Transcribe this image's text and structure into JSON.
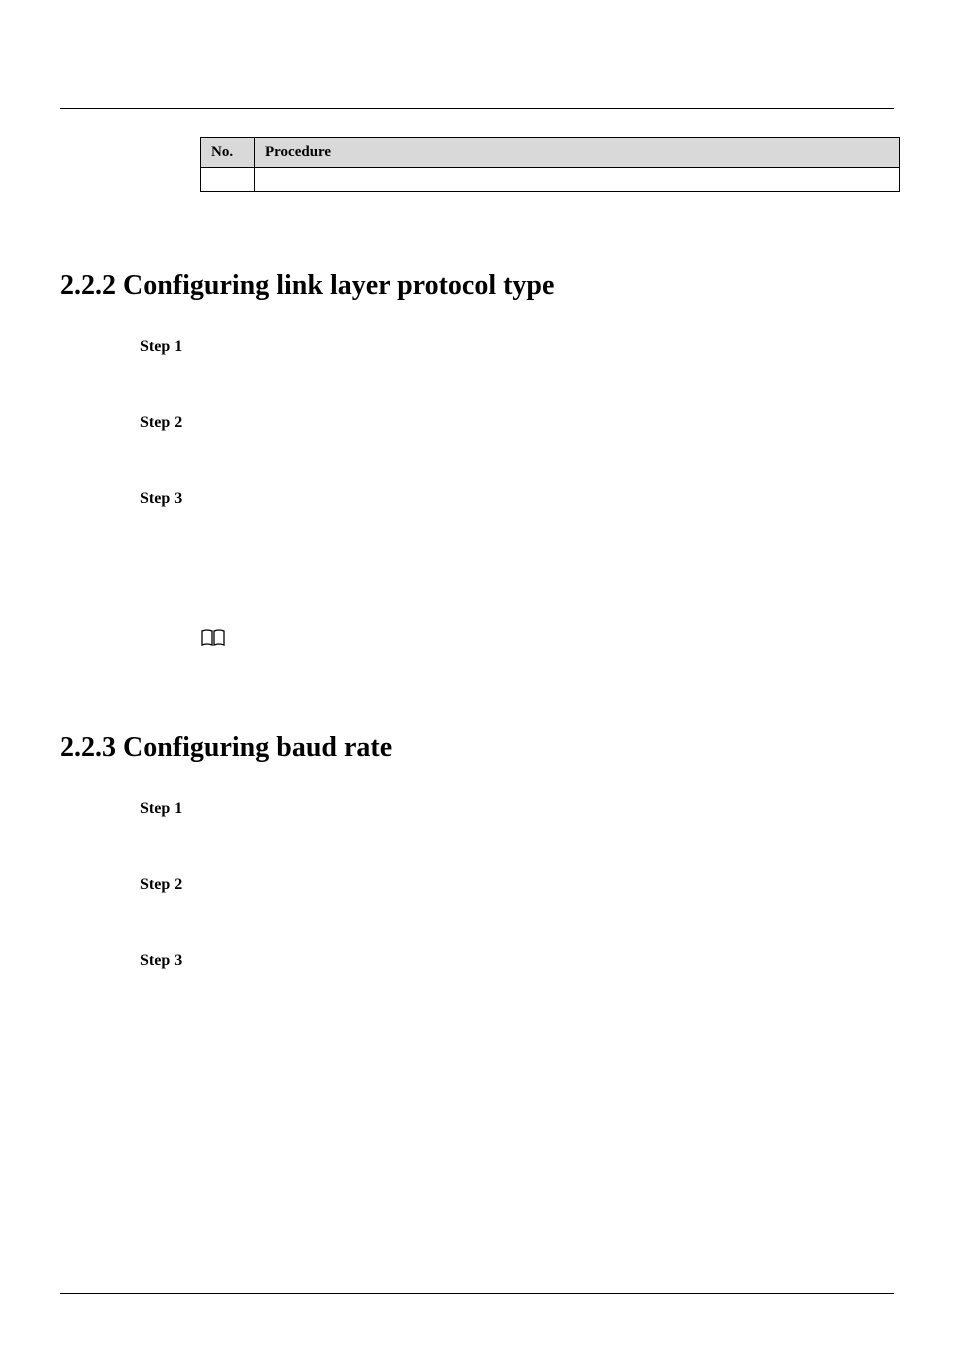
{
  "table": {
    "headers": {
      "no": "No.",
      "procedure": "Procedure"
    }
  },
  "sections": {
    "s222": {
      "heading": "2.2.2 Configuring link layer protocol type",
      "steps": {
        "s1": "Step 1",
        "s2": "Step 2",
        "s3": "Step 3"
      }
    },
    "s223": {
      "heading": "2.2.3 Configuring baud rate",
      "steps": {
        "s1": "Step 1",
        "s2": "Step 2",
        "s3": "Step 3"
      }
    }
  },
  "note_icon_glyph": "📖"
}
